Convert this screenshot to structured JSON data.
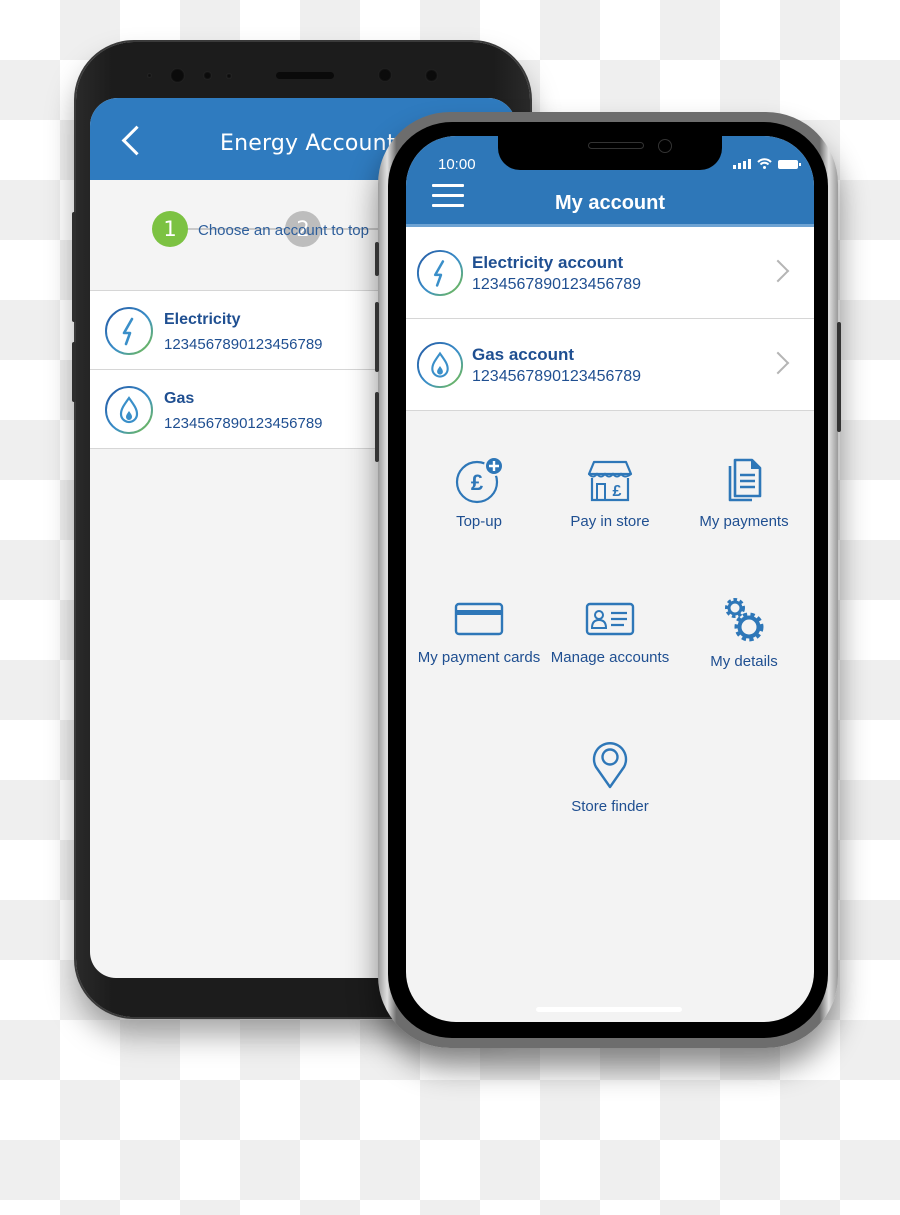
{
  "colors": {
    "header_blue": "#2e77b8",
    "text_blue": "#1f4f91",
    "step_active": "#7cc242",
    "step_inactive": "#bdbdbd",
    "icon_blue": "#2e77b8",
    "icon_green": "#7cc242"
  },
  "android": {
    "header": {
      "back_icon": "chevron-left-icon",
      "title": "Energy Accounts"
    },
    "stepper": {
      "steps": [
        "1",
        "2"
      ],
      "active_step": 1
    },
    "instruction": "Choose an account to top",
    "accounts": [
      {
        "icon": "lightning-icon",
        "name": "Electricity",
        "number": "1234567890123456789"
      },
      {
        "icon": "flame-icon",
        "name": "Gas",
        "number": "1234567890123456789"
      }
    ]
  },
  "iphone": {
    "status_bar": {
      "time": "10:00",
      "icons": [
        "signal-icon",
        "wifi-icon",
        "battery-icon"
      ]
    },
    "header": {
      "menu_icon": "hamburger-menu-icon",
      "title": "My account"
    },
    "accounts": [
      {
        "icon": "lightning-icon",
        "name": "Electricity account",
        "number": "1234567890123456789"
      },
      {
        "icon": "flame-icon",
        "name": "Gas account",
        "number": "1234567890123456789"
      }
    ],
    "menu": [
      {
        "icon": "top-up-pound-icon",
        "label": "Top-up"
      },
      {
        "icon": "store-icon",
        "label": "Pay in store"
      },
      {
        "icon": "documents-icon",
        "label": "My payments"
      },
      {
        "icon": "credit-card-icon",
        "label": "My payment cards"
      },
      {
        "icon": "id-card-icon",
        "label": "Manage accounts"
      },
      {
        "icon": "gears-icon",
        "label": "My details"
      },
      {
        "icon": "location-pin-icon",
        "label": "Store finder"
      }
    ]
  }
}
